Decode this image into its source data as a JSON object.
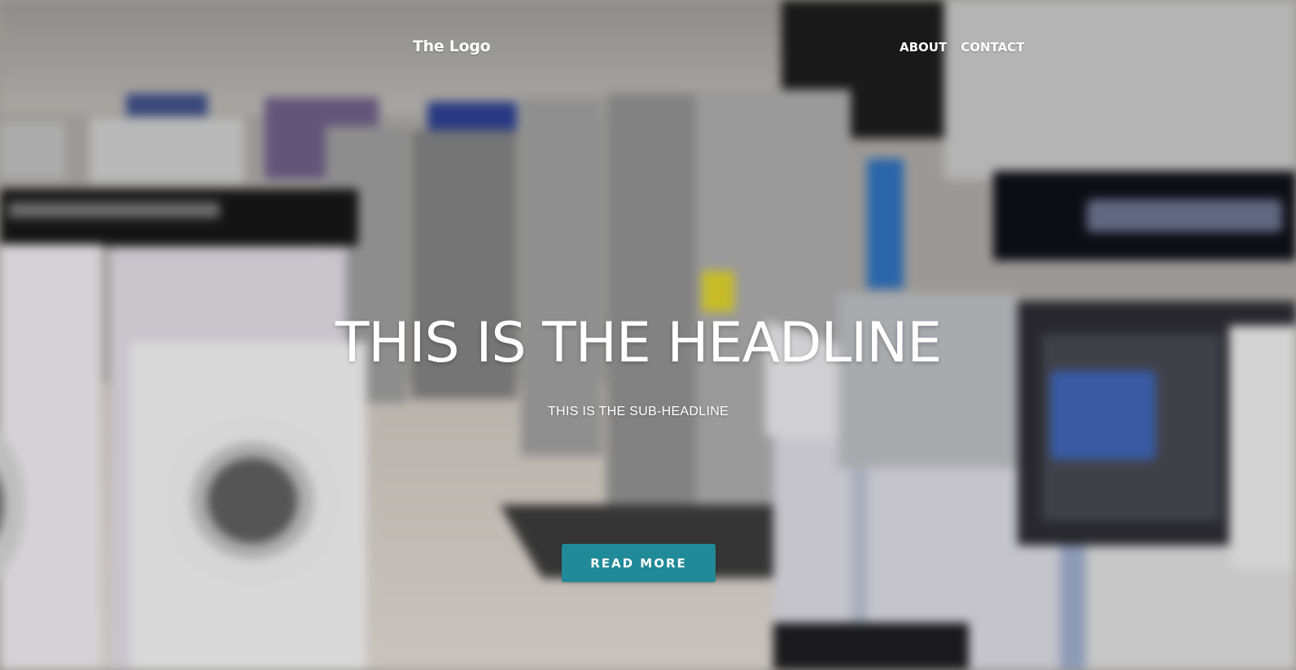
{
  "header": {
    "logo": "The Logo",
    "nav": [
      {
        "label": "ABOUT"
      },
      {
        "label": "CONTACT"
      }
    ]
  },
  "hero": {
    "headline": "THIS IS THE HEADLINE",
    "subheadline": "THIS IS THE SUB-HEADLINE",
    "cta_label": "READ MORE",
    "background_description_icon": "appliance-store-photo"
  },
  "colors": {
    "cta": "#218a98",
    "text": "#ffffff"
  }
}
